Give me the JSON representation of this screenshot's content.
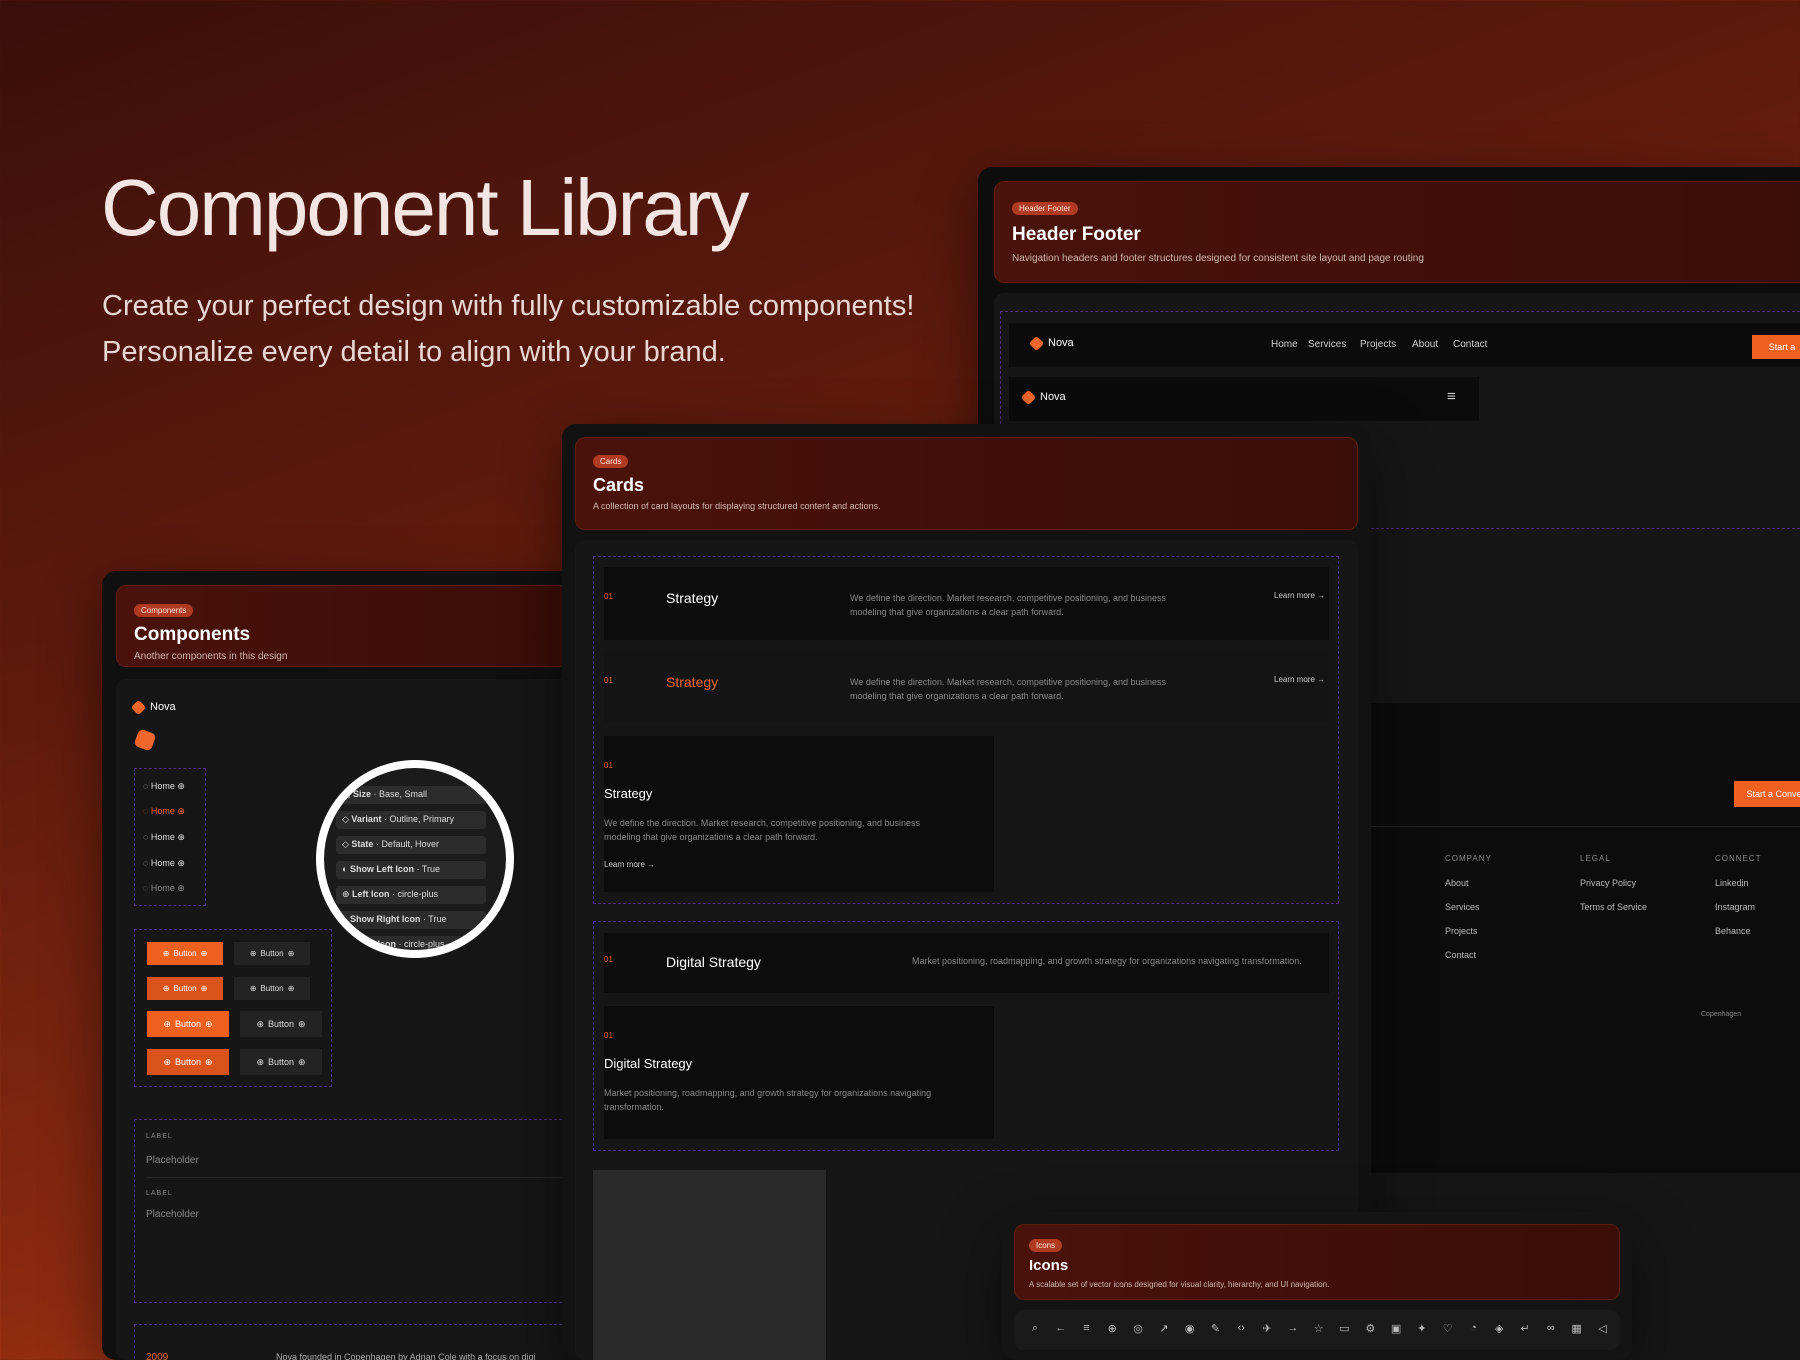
{
  "hero": {
    "title": "Component Library",
    "subtitle": "Create your perfect design with fully customizable components! Personalize every detail to align with your brand."
  },
  "header_footer": {
    "badge": "Header Footer",
    "title": "Header Footer",
    "desc": "Navigation headers and footer structures designed for consistent site layout and page routing",
    "brand": "Nova",
    "nav": [
      "Home",
      "Services",
      "Projects",
      "About",
      "Contact"
    ],
    "cta_partial": "Start a",
    "cta_full_partial": "Start a Conve",
    "footer_cols": [
      {
        "head": "COMPANY",
        "items": [
          "About",
          "Services",
          "Projects",
          "Contact"
        ]
      },
      {
        "head": "LEGAL",
        "items": [
          "Privacy Policy",
          "Terms of Service"
        ]
      },
      {
        "head": "CONNECT",
        "items": [
          "Linkedin",
          "Instagram",
          "Behance"
        ]
      }
    ],
    "footer_loc": "Copenhagen",
    "footer_loc2": "Be"
  },
  "cards": {
    "badge": "Cards",
    "title": "Cards",
    "desc": "A collection of card layouts for displaying structured content and actions.",
    "num": "01",
    "strategy": "Strategy",
    "strategy_desc": "We define the direction. Market research, competitive positioning, and business modeling that give organizations a clear path forward.",
    "learn_more": "Learn more",
    "digital": "Digital Strategy",
    "digital_desc": "Market positioning, roadmapping, and growth strategy for organizations navigating transformation."
  },
  "components": {
    "badge": "Components",
    "title": "Components",
    "desc": "Another components in this design",
    "brand": "Nova",
    "menu_items": [
      "Home",
      "Home",
      "Home",
      "Home",
      "Home"
    ],
    "button": "Button",
    "label": "LABEL",
    "placeholder": "Placeholder",
    "year": "2009",
    "founded": "Nova founded in Copenhagen by Adrian Cole with a focus on digi"
  },
  "props": [
    {
      "name": "Size",
      "value": "Base, Small"
    },
    {
      "name": "Variant",
      "value": "Outline, Primary"
    },
    {
      "name": "State",
      "value": "Default, Hover"
    },
    {
      "name": "Show Left Icon",
      "value": "True"
    },
    {
      "name": "Left Icon",
      "value": "circle-plus"
    },
    {
      "name": "Show Right Icon",
      "value": "True"
    },
    {
      "name": "Right Icon",
      "value": "circle-plus"
    }
  ],
  "icons": {
    "badge": "Icons",
    "title": "Icons",
    "desc": "A scalable set of vector icons designed for visual clarity, hierarchy, and UI navigation.",
    "glyphs": [
      "⌕",
      "←",
      "≡",
      "⊕",
      "◎",
      "↗",
      "◉",
      "✎",
      "‹›",
      "✈",
      "→",
      "☆",
      "▭",
      "⚙",
      "▣",
      "✦",
      "♡",
      "◔",
      "◈",
      "↵",
      "∞",
      "▦",
      "◁"
    ]
  },
  "colors": {
    "accent": "#f0662a",
    "panel": "#101010",
    "header_bg": "#4a120a",
    "dashed": "#4b2e7a"
  }
}
